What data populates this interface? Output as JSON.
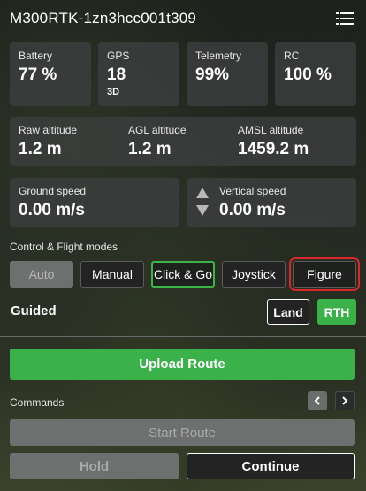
{
  "header": {
    "title": "M300RTK-1zn3hcc001t309",
    "menu_icon": "menu-list-icon"
  },
  "telemetry_cards": {
    "battery": {
      "label": "Battery",
      "value": "77 %"
    },
    "gps": {
      "label": "GPS",
      "value": "18",
      "sub": "3D"
    },
    "telemetry": {
      "label": "Telemetry",
      "value": "99%"
    },
    "rc": {
      "label": "RC",
      "value": "100 %"
    }
  },
  "altitude": {
    "raw": {
      "label": "Raw altitude",
      "value": "1.2 m"
    },
    "agl": {
      "label": "AGL altitude",
      "value": "1.2 m"
    },
    "amsl": {
      "label": "AMSL altitude",
      "value": "1459.2 m"
    }
  },
  "speed": {
    "ground": {
      "label": "Ground speed",
      "value": "0.00 m/s"
    },
    "vertical": {
      "label": "Vertical speed",
      "value": "0.00 m/s"
    }
  },
  "modes": {
    "section_label": "Control & Flight modes",
    "auto": "Auto",
    "manual": "Manual",
    "click_go": "Click & Go",
    "joystick": "Joystick",
    "figure": "Figure"
  },
  "flight_mode": {
    "label": "Guided",
    "land": "Land",
    "rth": "RTH"
  },
  "upload_route": "Upload Route",
  "commands": {
    "label": "Commands",
    "start_route": "Start Route",
    "hold": "Hold",
    "continue": "Continue"
  },
  "colors": {
    "accent_green": "#3bb14a",
    "highlight_red": "#d8262a"
  }
}
